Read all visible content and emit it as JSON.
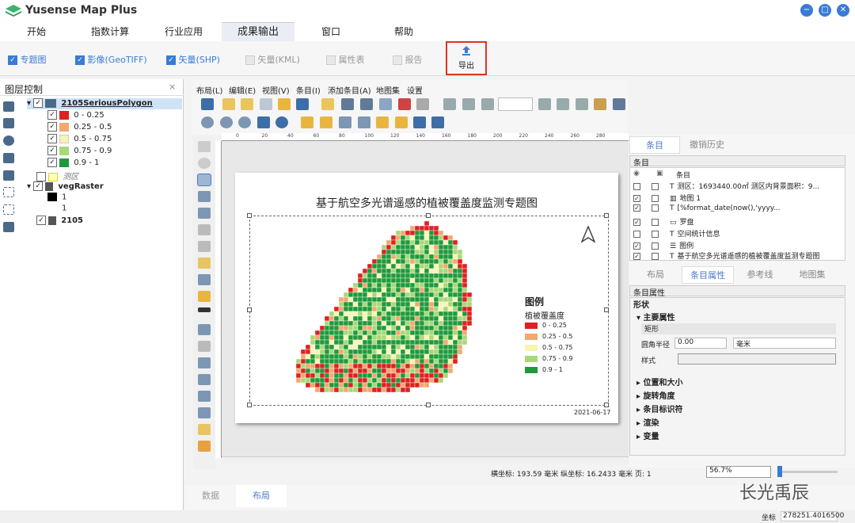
{
  "app": {
    "title": "Yusense Map Plus"
  },
  "menu": {
    "tabs": [
      "开始",
      "指数计算",
      "行业应用",
      "成果输出",
      "窗口",
      "帮助"
    ],
    "active": "成果输出"
  },
  "ribbon": {
    "items": [
      {
        "label": "专题图",
        "checked": true,
        "enabled": true
      },
      {
        "label": "影像(GeoTIFF)",
        "checked": true,
        "enabled": true
      },
      {
        "label": "矢量(SHP)",
        "checked": true,
        "enabled": true
      },
      {
        "label": "矢量(KML)",
        "checked": false,
        "enabled": false
      },
      {
        "label": "属性表",
        "checked": false,
        "enabled": false
      },
      {
        "label": "报告",
        "checked": false,
        "enabled": false
      }
    ],
    "export_label": "导出"
  },
  "layer_panel": {
    "title": "图层控制",
    "close": "×",
    "layers": [
      {
        "name": "2105SeriousPolygon"
      },
      {
        "class": "0 - 0.25",
        "color": "#e02020"
      },
      {
        "class": "0.25 - 0.5",
        "color": "#f2a86e"
      },
      {
        "class": "0.5 - 0.75",
        "color": "#f8f4b4"
      },
      {
        "class": "0.75 - 0.9",
        "color": "#a8d878"
      },
      {
        "class": "0.9 - 1",
        "color": "#1f9a3a"
      },
      {
        "name": "测区"
      },
      {
        "name": "vegRaster"
      },
      {
        "class": "1",
        "color": "#000000"
      },
      {
        "class": "1",
        "color": "#ffffff"
      },
      {
        "name": "2105"
      }
    ]
  },
  "layout_menu": [
    "布局(L)",
    "编辑(E)",
    "视图(V)",
    "条目(I)",
    "添加条目(A)",
    "地图集",
    "设置"
  ],
  "map": {
    "title": "基于航空多光谱遥感的植被覆盖度监测专题图",
    "legend_title": "图例",
    "legend_subtitle": "植被覆盖度",
    "legend": [
      {
        "label": "0 - 0.25",
        "color": "#e02020"
      },
      {
        "label": "0.25 - 0.5",
        "color": "#f2a86e"
      },
      {
        "label": "0.5 - 0.75",
        "color": "#f8f4b4"
      },
      {
        "label": "0.75 - 0.9",
        "color": "#a8d878"
      },
      {
        "label": "0.9 - 1",
        "color": "#1f9a3a"
      }
    ],
    "date": "2021-06-17",
    "north_arrow": "north-arrow-icon"
  },
  "ruler_ticks": [
    "0",
    "20",
    "40",
    "60",
    "80",
    "100",
    "120",
    "140",
    "160",
    "180",
    "200",
    "220",
    "240",
    "260",
    "280"
  ],
  "right_panel": {
    "tabs": [
      "条目",
      "撤销历史"
    ],
    "items_header": "条目",
    "col_header": "条目",
    "items": [
      {
        "label": "测区：1693440.00㎡ 测区内背景面积：9...",
        "visible": false
      },
      {
        "label": "地图 1",
        "visible": true
      },
      {
        "label": "[%format_date(now(),'yyyy...",
        "visible": true
      },
      {
        "label": "罗盘",
        "visible": true
      },
      {
        "label": "空间统计信息",
        "visible": false
      },
      {
        "label": "图例",
        "visible": true
      },
      {
        "label": "基于航空多光谱遥感的植被覆盖度监测专题图",
        "visible": true
      }
    ],
    "tabs2": [
      "布局",
      "条目属性",
      "参考线",
      "地图集"
    ],
    "props_header": "条目属性",
    "section": "形状",
    "main_props": "主要属性",
    "shape": "矩形",
    "corner_label": "圆角半径",
    "corner_value": "0.00",
    "corner_unit": "毫米",
    "style_label": "样式",
    "groups": [
      "位置和大小",
      "旋转角度",
      "条目标识符",
      "渲染",
      "变量"
    ]
  },
  "status": {
    "coords": "横坐标: 193.59 毫米 纵坐标: 16.2433 毫米 页: 1",
    "zoom": "56.7%",
    "watermark": "长光禹辰",
    "footer_label": "坐标",
    "footer_coords": "278251.4016500"
  },
  "bottom_tabs": [
    "数据",
    "布局"
  ]
}
